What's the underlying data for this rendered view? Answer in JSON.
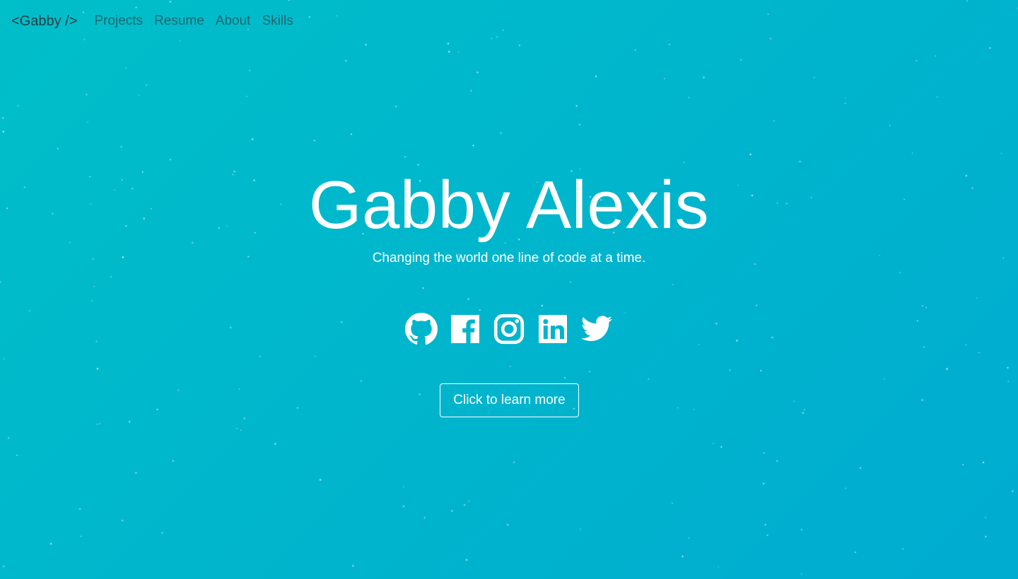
{
  "colors": {
    "background_start": "#00bfc9",
    "background_end": "#00acd0",
    "text": "#ffffff",
    "brand": "#2b3a3f"
  },
  "navbar": {
    "brand": "<Gabby />",
    "links": [
      {
        "label": "Projects"
      },
      {
        "label": "Resume"
      },
      {
        "label": "About"
      },
      {
        "label": "Skills"
      }
    ]
  },
  "hero": {
    "name": "Gabby Alexis",
    "tagline": "Changing the world one line of code at a time.",
    "social_icons": [
      "github-icon",
      "facebook-icon",
      "instagram-icon",
      "linkedin-icon",
      "twitter-icon"
    ],
    "cta_label": "Click to learn more"
  }
}
